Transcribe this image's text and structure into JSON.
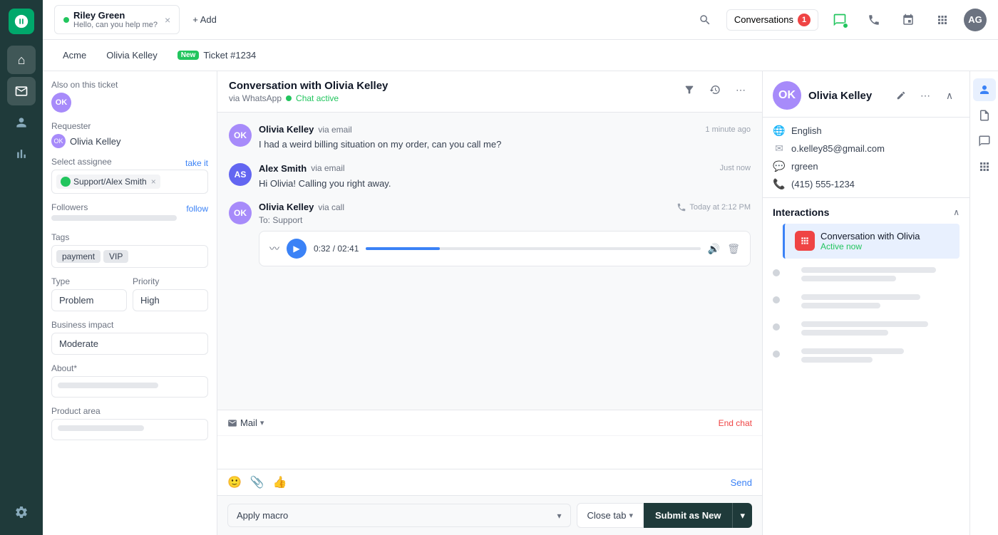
{
  "sidebar": {
    "logo_text": "Z",
    "items": [
      {
        "id": "home",
        "icon": "⌂",
        "active": false
      },
      {
        "id": "tickets",
        "icon": "☰",
        "active": true
      },
      {
        "id": "users",
        "icon": "👤",
        "active": false
      },
      {
        "id": "reports",
        "icon": "📊",
        "active": false
      },
      {
        "id": "settings",
        "icon": "⚙",
        "active": false
      }
    ]
  },
  "topbar": {
    "tab_label": "Riley Green",
    "tab_subtitle": "Hello, can you help me?",
    "add_label": "+ Add",
    "conversations_label": "Conversations",
    "conversations_count": "1",
    "close_icon": "×"
  },
  "subtabs": [
    {
      "id": "acme",
      "label": "Acme"
    },
    {
      "id": "olivia",
      "label": "Olivia Kelley"
    },
    {
      "id": "ticket",
      "label": "Ticket #1234",
      "new": true
    }
  ],
  "left_panel": {
    "also_on_ticket_label": "Also on this ticket",
    "requester_label": "Requester",
    "requester_name": "Olivia Kelley",
    "select_assignee_label": "Select assignee",
    "take_it_label": "take it",
    "assignee_name": "Support/Alex Smith",
    "followers_label": "Followers",
    "follow_label": "follow",
    "tags_label": "Tags",
    "tags": [
      "payment",
      "VIP"
    ],
    "type_label": "Type",
    "type_value": "Problem",
    "priority_label": "Priority",
    "priority_value": "High",
    "business_impact_label": "Business impact",
    "business_impact_value": "Moderate",
    "about_label": "About*",
    "product_area_label": "Product area"
  },
  "conversation": {
    "title": "Conversation with Olivia Kelley",
    "via": "via WhatsApp",
    "status": "Chat active",
    "messages": [
      {
        "id": "msg1",
        "sender": "Olivia Kelley",
        "via": "via email",
        "time": "1 minute ago",
        "text": "I had a weird billing situation on my order, can you call me?",
        "initials": "OK"
      },
      {
        "id": "msg2",
        "sender": "Alex Smith",
        "via": "via email",
        "time": "Just now",
        "text": "Hi Olivia! Calling you right away.",
        "initials": "AS",
        "is_agent": true
      }
    ],
    "call": {
      "sender": "Olivia Kelley",
      "via": "via call",
      "time": "Today at 2:12 PM",
      "to": "To: Support",
      "current_time": "0:32",
      "total_time": "02:41",
      "initials": "OK"
    },
    "compose": {
      "channel_label": "Mail",
      "end_chat_label": "End chat",
      "send_label": "Send"
    },
    "macro_label": "Apply macro",
    "close_tab_label": "Close tab",
    "submit_label": "Submit as",
    "submit_status": "New"
  },
  "contact": {
    "name": "Olivia Kelley",
    "language": "English",
    "email": "o.kelley85@gmail.com",
    "username": "rgreen",
    "phone": "(415) 555-1234",
    "interactions_label": "Interactions",
    "active_interaction_title": "Conversation with Olivia",
    "active_interaction_status": "Active now"
  }
}
